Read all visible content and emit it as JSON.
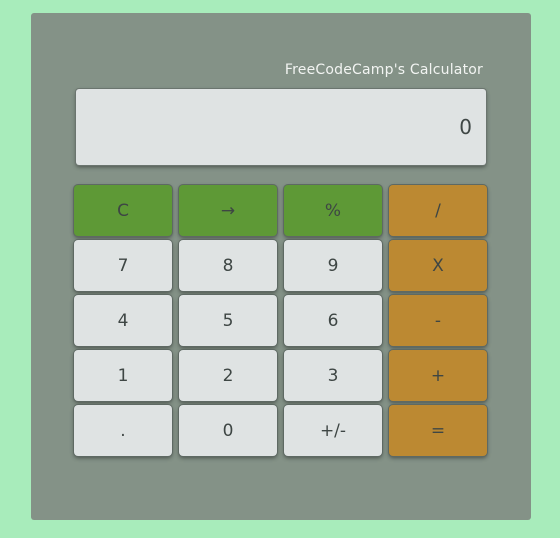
{
  "calculator": {
    "title": "FreeCodeCamp's Calculator",
    "display": "0"
  },
  "keys": {
    "clear": "C",
    "backspace": "→",
    "percent": "%",
    "divide": "/",
    "seven": "7",
    "eight": "8",
    "nine": "9",
    "multiply": "X",
    "four": "4",
    "five": "5",
    "six": "6",
    "subtract": "-",
    "one": "1",
    "two": "2",
    "three": "3",
    "add": "+",
    "decimal": ".",
    "zero": "0",
    "negate": "+/-",
    "equals": "="
  },
  "colors": {
    "page_background": "#a8ecbb",
    "calculator_body": "#849287",
    "number_key": "#dfe3e3",
    "utility_key": "#5e9936",
    "operator_key": "#bc8932"
  }
}
